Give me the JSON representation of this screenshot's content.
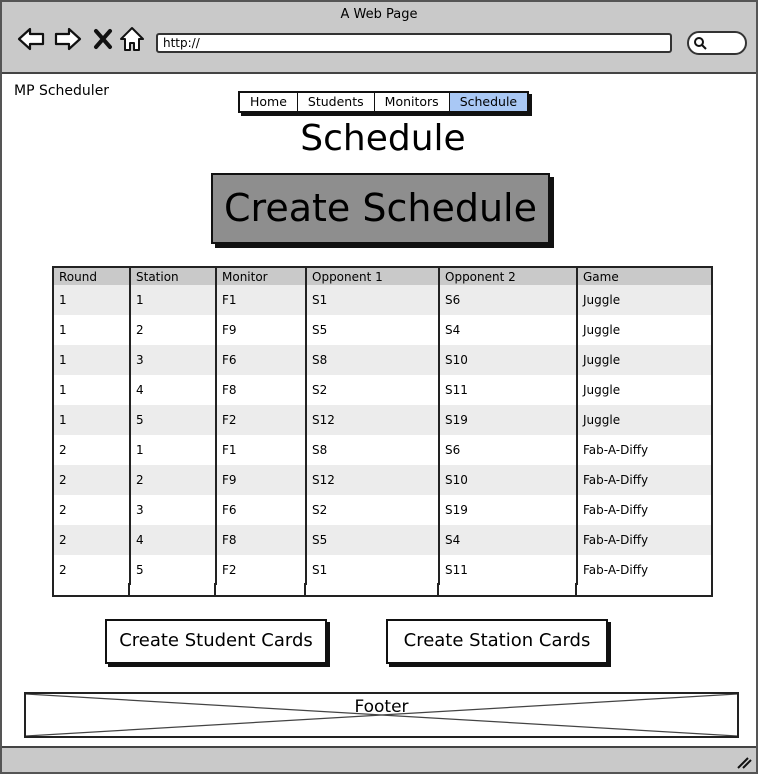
{
  "window": {
    "title": "A Web Page",
    "url": "http://"
  },
  "icons": {
    "back": "back-arrow-icon",
    "forward": "forward-arrow-icon",
    "stop": "close-icon",
    "home": "home-icon",
    "search": "search-icon",
    "grip": "resize-grip-icon"
  },
  "app": {
    "name": "MP Scheduler"
  },
  "nav": {
    "tabs": [
      {
        "label": "Home",
        "active": false
      },
      {
        "label": "Students",
        "active": false
      },
      {
        "label": "Monitors",
        "active": false
      },
      {
        "label": "Schedule",
        "active": true
      }
    ]
  },
  "page": {
    "title": "Schedule",
    "create_button": "Create Schedule"
  },
  "schedule_table": {
    "headers": [
      "Round",
      "Station",
      "Monitor",
      "Opponent 1",
      "Opponent 2",
      "Game"
    ],
    "rows": [
      [
        "1",
        "1",
        "F1",
        "S1",
        "S6",
        "Juggle"
      ],
      [
        "1",
        "2",
        "F9",
        "S5",
        "S4",
        "Juggle"
      ],
      [
        "1",
        "3",
        "F6",
        "S8",
        "S10",
        "Juggle"
      ],
      [
        "1",
        "4",
        "F8",
        "S2",
        "S11",
        "Juggle"
      ],
      [
        "1",
        "5",
        "F2",
        "S12",
        "S19",
        "Juggle"
      ],
      [
        "2",
        "1",
        "F1",
        "S8",
        "S6",
        "Fab-A-Diffy"
      ],
      [
        "2",
        "2",
        "F9",
        "S12",
        "S10",
        "Fab-A-Diffy"
      ],
      [
        "2",
        "3",
        "F6",
        "S2",
        "S19",
        "Fab-A-Diffy"
      ],
      [
        "2",
        "4",
        "F8",
        "S5",
        "S4",
        "Fab-A-Diffy"
      ],
      [
        "2",
        "5",
        "F2",
        "S1",
        "S11",
        "Fab-A-Diffy"
      ]
    ]
  },
  "actions": {
    "student_cards": "Create Student Cards",
    "station_cards": "Create Station Cards"
  },
  "footer": {
    "label": "Footer"
  },
  "colors": {
    "chrome": "#c9c9c9",
    "active_tab": "#a9c8f5",
    "primary_button": "#8e8e8e",
    "alt_row": "#ececec"
  }
}
